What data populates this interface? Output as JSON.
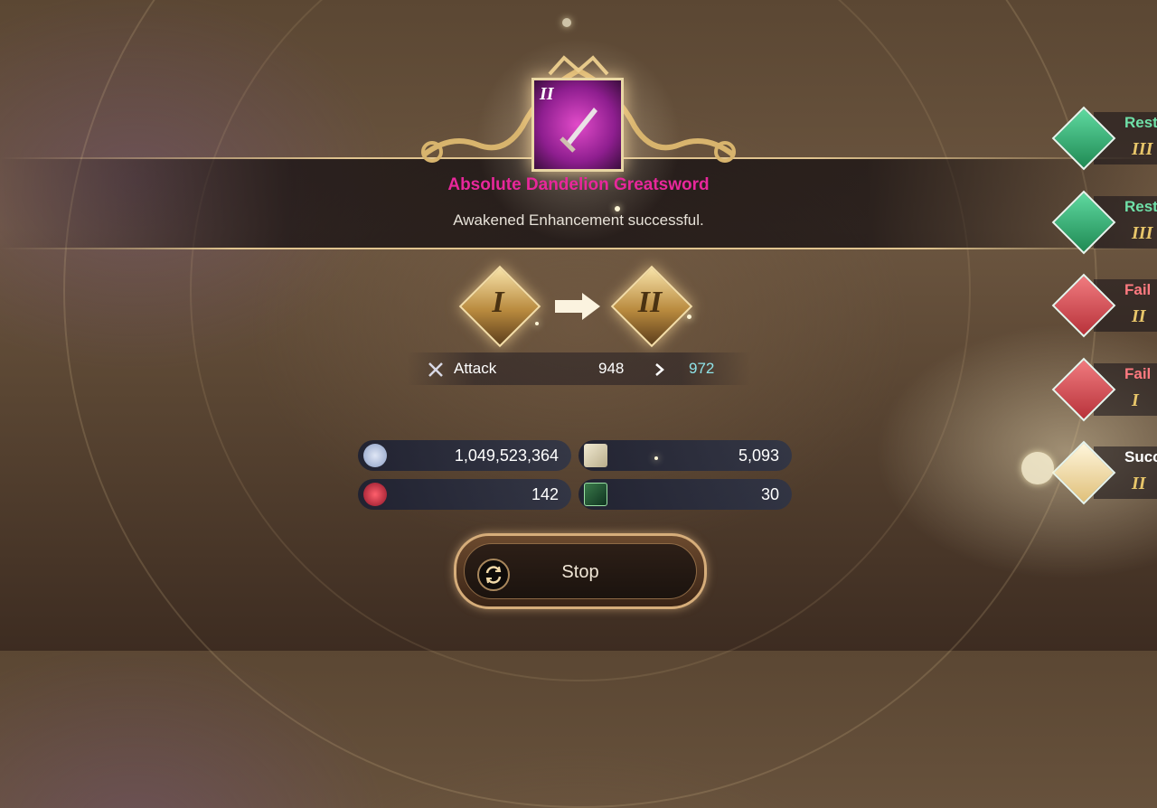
{
  "result": {
    "item_name": "Absolute Dandelion Greatsword",
    "item_level": "II",
    "message": "Awakened Enhancement successful.",
    "from_level": "I",
    "to_level": "II"
  },
  "stat": {
    "name": "Attack",
    "old_value": "948",
    "new_value": "972"
  },
  "resources": [
    {
      "icon": "silver-coin-icon",
      "value": "1,049,523,364"
    },
    {
      "icon": "scroll-icon",
      "value": "5,093"
    },
    {
      "icon": "red-crystal-icon",
      "value": "142"
    },
    {
      "icon": "green-tome-icon",
      "value": "30"
    }
  ],
  "stop_button": {
    "label": "Stop"
  },
  "history": [
    {
      "status": "Rest",
      "level": "III",
      "type": "restore"
    },
    {
      "status": "Rest",
      "level": "III",
      "type": "restore"
    },
    {
      "status": "Fail",
      "level": "II",
      "type": "fail"
    },
    {
      "status": "Fail",
      "level": "I",
      "type": "fail"
    },
    {
      "status": "Succ",
      "level": "II",
      "type": "success"
    }
  ],
  "colors": {
    "item_name": "#e8279b",
    "stat_new": "#8fe3e8",
    "restore": "#2fae6e",
    "fail": "#d6454b",
    "success": "#e9cf86",
    "level": "#e8c66a"
  }
}
